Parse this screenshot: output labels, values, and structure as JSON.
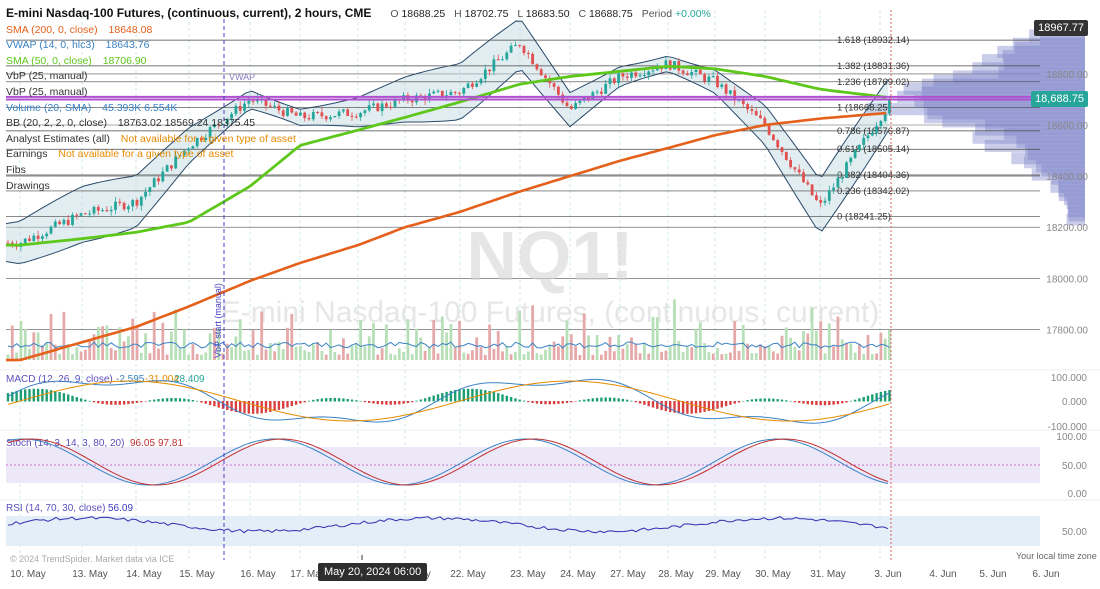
{
  "header": {
    "symbol_title": "E-mini Nasdaq-100 Futures, (continuous, current), 2 hours, CME",
    "open_label": "O",
    "open": "18688.25",
    "high_label": "H",
    "high": "18702.75",
    "low_label": "L",
    "low": "18683.50",
    "close_label": "C",
    "close": "18688.75",
    "period_label": "Period",
    "period": "+0.00%"
  },
  "legend": [
    {
      "label": "SMA (200, 0, close)",
      "value": "18648.08",
      "color": "#e4601b"
    },
    {
      "label": "VWAP (14, 0, hlc3)",
      "value": "18643.76",
      "color": "#3a82c4"
    },
    {
      "label": "SMA (50, 0, close)",
      "value": "18706.90",
      "color": "#5ec71b"
    },
    {
      "label": "VbP (25, manual)",
      "value": "",
      "color": "#333333"
    },
    {
      "label": "VbP (25, manual)",
      "value": "",
      "color": "#333333"
    },
    {
      "label": "Volume (20, SMA)",
      "value": "45.393K 6.554K",
      "color": "#3a82c4"
    },
    {
      "label": "BB (20, 2, 2, 0, close)",
      "value": "18763.02 18569.24 18375.45",
      "color": "#333333"
    },
    {
      "label": "Analyst Estimates (all)",
      "value": "Not available for a given type of asset",
      "color": "#333333",
      "value_color": "#e58a00"
    },
    {
      "label": "Earnings",
      "value": "Not available for a given type of asset",
      "color": "#333333",
      "value_color": "#e58a00"
    },
    {
      "label": "Fibs",
      "value": "",
      "color": "#333333"
    },
    {
      "label": "Drawings",
      "value": "",
      "color": "#333333"
    }
  ],
  "watermark": {
    "symbol": "NQ1!",
    "name": "E-mini Nasdaq-100 Futures, (continuous, current)"
  },
  "price_axis": {
    "ticks": [
      "18967.77",
      "18800.00",
      "18600.00",
      "18400.00",
      "18200.00",
      "18000.00",
      "17800.00"
    ],
    "current": "18,688.75",
    "high_tag": "18967.77",
    "current_color": "#26a69a",
    "high_tag_color": "#333333"
  },
  "fibs": [
    {
      "label": "1.618 (18932.14)",
      "price": 18932.14
    },
    {
      "label": "1.382 (18831.36)",
      "price": 18831.36
    },
    {
      "label": "1.236 (18769.02)",
      "price": 18769.02
    },
    {
      "label": "1 (18668.25)",
      "price": 18668.25
    },
    {
      "label": "0.786 (18576.87)",
      "price": 18576.87
    },
    {
      "label": "0.618 (18505.14)",
      "price": 18505.14
    },
    {
      "label": "0.382 (18404.36)",
      "price": 18404.36
    },
    {
      "label": "0.236 (18342.02)",
      "price": 18342.02
    },
    {
      "label": "0 (18241.25)",
      "price": 18241.25
    }
  ],
  "vbp_label": "VbP start (manual)",
  "vwap_label": "VWAP",
  "macd": {
    "label": "MACD (12, 26, 9, close)",
    "values": [
      "-2.595",
      "-31.004",
      "28.409"
    ],
    "axis": [
      "100.000",
      "0.000",
      "-100.000"
    ]
  },
  "stoch": {
    "label": "Stoch (14, 3, 14, 3, 80, 20)",
    "values": [
      "96.05",
      "97.81"
    ],
    "axis": [
      "100.00",
      "50.00",
      "0.00"
    ]
  },
  "rsi": {
    "label": "RSI (14, 70, 30, close)",
    "value": "56.09",
    "axis": [
      "50.00"
    ]
  },
  "footer": {
    "copyright": "© 2024 TrendSpider. Market data via ICE",
    "tz": "Your local time zone",
    "crosshair_date": "May 20, 2024 06:00"
  },
  "dates": [
    "10. May",
    "13. May",
    "14. May",
    "15. May",
    "16. May",
    "17. May",
    "21. May",
    "22. May",
    "23. May",
    "24. May",
    "27. May",
    "28. May",
    "29. May",
    "30. May",
    "31. May",
    "3. Jun",
    "4. Jun",
    "5. Jun",
    "6. Jun"
  ],
  "chart_data": {
    "type": "line",
    "instrument": "E-mini Nasdaq-100 Futures, (continuous, current)",
    "interval": "2 hours",
    "x": [
      "10. May",
      "13. May",
      "14. May",
      "15. May",
      "16. May",
      "17. May",
      "20. May",
      "21. May",
      "22. May",
      "23. May",
      "24. May",
      "27. May",
      "28. May",
      "29. May",
      "30. May",
      "31. May",
      "3. Jun"
    ],
    "series": [
      {
        "name": "Close",
        "values": [
          18140,
          18250,
          18300,
          18520,
          18700,
          18630,
          18650,
          18700,
          18730,
          18920,
          18660,
          18790,
          18840,
          18770,
          18600,
          18280,
          18688.75
        ]
      },
      {
        "name": "SMA (200, 0, close)",
        "values": [
          17680,
          17750,
          17810,
          17890,
          17990,
          18060,
          18130,
          18200,
          18260,
          18340,
          18400,
          18460,
          18510,
          18560,
          18600,
          18625,
          18648.08
        ]
      },
      {
        "name": "SMA (50, 0, close)",
        "values": [
          18130,
          18155,
          18180,
          18220,
          18360,
          18520,
          18580,
          18630,
          18690,
          18760,
          18790,
          18810,
          18830,
          18820,
          18790,
          18740,
          18706.9
        ]
      }
    ],
    "ylim": [
      17700,
      19050
    ],
    "fib_levels": [
      18932.14,
      18831.36,
      18769.02,
      18668.25,
      18576.87,
      18505.14,
      18404.36,
      18342.02,
      18241.25
    ],
    "macd": {
      "macd": -2.595,
      "signal": -31.004,
      "histogram": 28.409,
      "ylim": [
        -100,
        100
      ]
    },
    "stoch": {
      "k": 96.05,
      "d": 97.81,
      "ylim": [
        0,
        100
      ]
    },
    "rsi": {
      "value": 56.09,
      "ylim": [
        0,
        100
      ]
    },
    "legend_position": "top-left",
    "grid": true
  }
}
